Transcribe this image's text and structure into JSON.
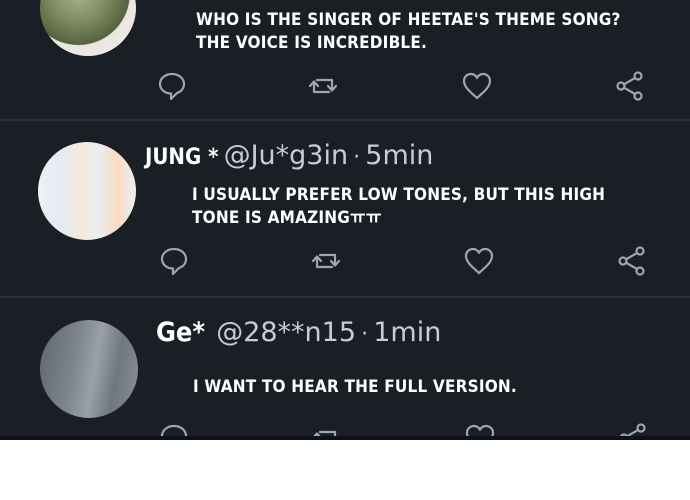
{
  "tweets": [
    {
      "avatar": "avatar-olive-figure",
      "text_lines": [
        "WHO IS THE SINGER OF HEETAE'S THEME SONG?",
        "THE VOICE IS INCREDIBLE."
      ]
    },
    {
      "display_name": "JUNG *",
      "handle": "@Ju*g3in",
      "separator": "·",
      "time": "5min",
      "avatar": "avatar-pastel-stripes",
      "text_lines": [
        "I USUALLY PREFER LOW TONES, BUT THIS HIGH",
        "TONE IS AMAZINGㅠㅠ"
      ]
    },
    {
      "display_name": "Ge*",
      "handle": "@28**n15",
      "separator": "·",
      "time": "1min",
      "avatar": "avatar-gray-room",
      "text_lines": [
        "I WANT TO HEAR THE FULL VERSION."
      ]
    }
  ],
  "icons": {
    "reply": "comment-bubble-icon",
    "retweet": "retweet-icon",
    "like": "heart-icon",
    "share": "share-icon"
  },
  "colors": {
    "background": "#1a1f26",
    "text": "#ffffff",
    "secondary_text": "#c9cdd3",
    "icon": "#9ea6b0"
  }
}
